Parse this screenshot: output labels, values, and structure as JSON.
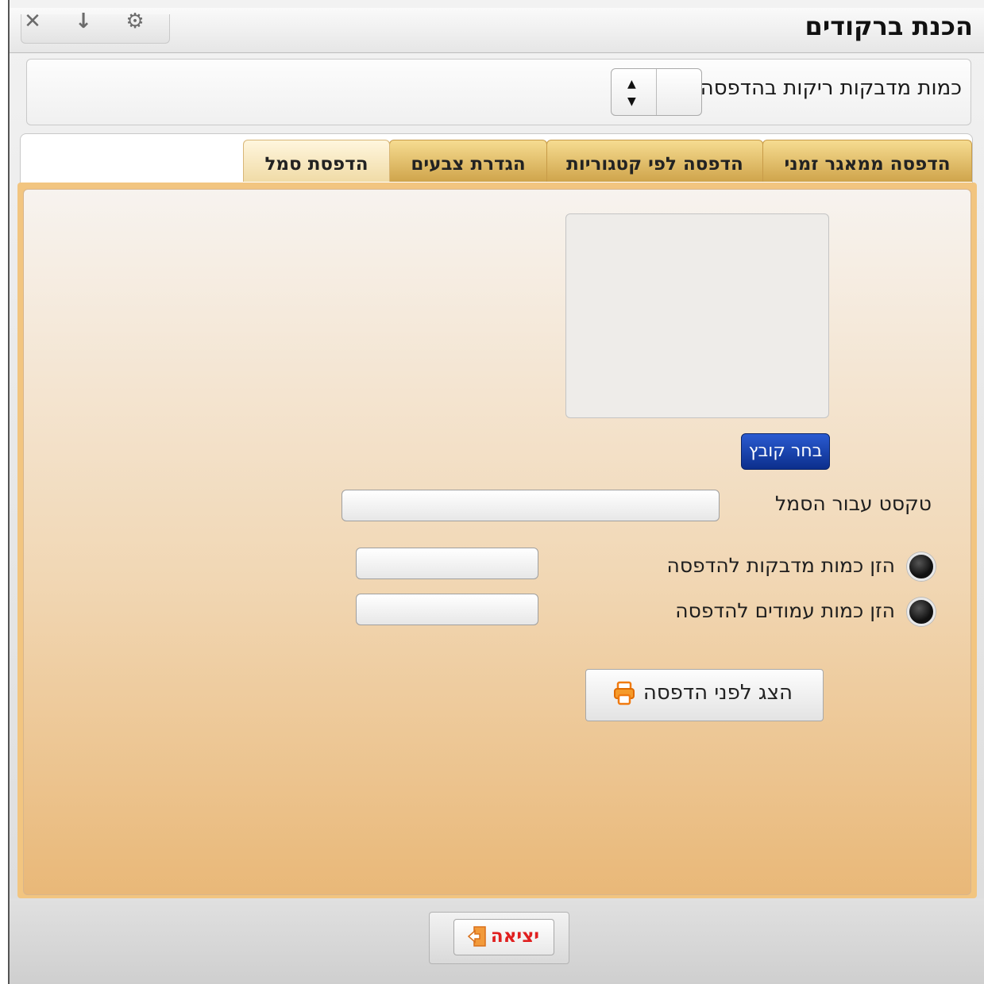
{
  "window": {
    "title": "הכנת ברקודים",
    "controls": [
      "close-icon",
      "pin-icon",
      "settings-icon"
    ]
  },
  "empty_labels": {
    "label": "כמות מדבקות ריקות בהדפסה",
    "value": ""
  },
  "tabs": [
    {
      "label": "הדפסה ממאגר זמני",
      "active": false
    },
    {
      "label": "הדפסה לפי קטגוריות",
      "active": false
    },
    {
      "label": "הגדרת צבעים",
      "active": false
    },
    {
      "label": "הדפסת סמל",
      "active": true
    }
  ],
  "logo_panel": {
    "choose_file_label": "בחר קובץ",
    "symbol_text_label": "טקסט עבור הסמל",
    "symbol_text_value": "",
    "radio_labels_qty": "הזן כמות מדבקות להדפסה",
    "radio_pages_qty": "הזן כמות עמודים להדפסה",
    "labels_qty_value": "",
    "pages_qty_value": "",
    "preview_label": "הצג לפני הדפסה"
  },
  "footer": {
    "exit_label": "יציאה"
  },
  "colors": {
    "tab_gold": "#e2bd6a",
    "panel_peach": "#f1d7b4",
    "choose_button_blue": "#1a45b0",
    "exit_red": "#e02020"
  }
}
